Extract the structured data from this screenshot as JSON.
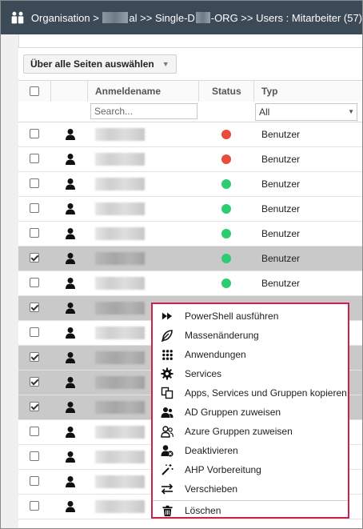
{
  "title": {
    "prefix": "Organisation >",
    "mid1": "al >> Single-D",
    "mid2": "-ORG >> Users : Mitarbeiter (57)"
  },
  "toolbar": {
    "select_all_label": "Über alle Seiten auswählen"
  },
  "columns": {
    "login": "Anmeldename",
    "status": "Status",
    "type": "Typ"
  },
  "filters": {
    "search_placeholder": "Search...",
    "type_value": "All"
  },
  "rows": [
    {
      "checked": false,
      "status": "red",
      "type": "Benutzer"
    },
    {
      "checked": false,
      "status": "red",
      "type": "Benutzer"
    },
    {
      "checked": false,
      "status": "green",
      "type": "Benutzer"
    },
    {
      "checked": false,
      "status": "green",
      "type": "Benutzer"
    },
    {
      "checked": false,
      "status": "green",
      "type": "Benutzer"
    },
    {
      "checked": true,
      "status": "green",
      "type": "Benutzer"
    },
    {
      "checked": false,
      "status": "green",
      "type": "Benutzer"
    },
    {
      "checked": true,
      "status": "",
      "type": ""
    },
    {
      "checked": false,
      "status": "",
      "type": ""
    },
    {
      "checked": true,
      "status": "",
      "type": ""
    },
    {
      "checked": true,
      "status": "",
      "type": ""
    },
    {
      "checked": true,
      "status": "",
      "type": ""
    },
    {
      "checked": false,
      "status": "",
      "type": ""
    },
    {
      "checked": false,
      "status": "",
      "type": ""
    },
    {
      "checked": false,
      "status": "",
      "type": ""
    },
    {
      "checked": false,
      "status": "",
      "type": ""
    }
  ],
  "context_menu": [
    {
      "label": "PowerShell ausführen",
      "icon": "fast-forward-icon"
    },
    {
      "label": "Massenänderung",
      "icon": "feather-icon"
    },
    {
      "label": "Anwendungen",
      "icon": "grid-dots-icon"
    },
    {
      "label": "Services",
      "icon": "gear-icon"
    },
    {
      "label": "Apps, Services und Gruppen kopieren",
      "icon": "copy-icon"
    },
    {
      "label": "AD Gruppen zuweisen",
      "icon": "user-group-icon"
    },
    {
      "label": "Azure Gruppen zuweisen",
      "icon": "user-group-outline-icon"
    },
    {
      "label": "Deaktivieren",
      "icon": "user-disable-icon"
    },
    {
      "label": "AHP Vorbereitung",
      "icon": "magic-wand-icon"
    },
    {
      "label": "Verschieben",
      "icon": "swap-arrows-icon"
    },
    {
      "label": "Löschen",
      "icon": "trash-icon"
    }
  ],
  "colors": {
    "titlebar": "#3c4a57",
    "menu_border": "#c8234a",
    "status_red": "#e74c3c",
    "status_green": "#2ecc71",
    "selected_row": "#c9c9c9"
  }
}
